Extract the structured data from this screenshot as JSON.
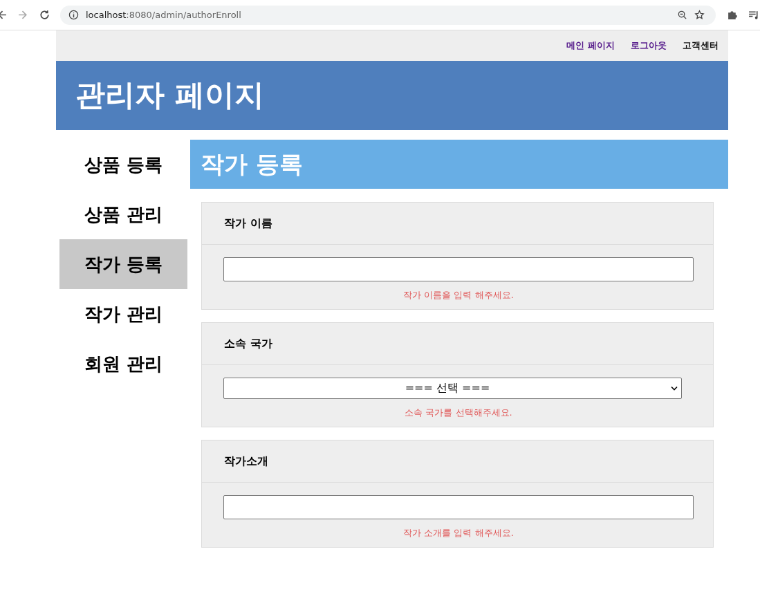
{
  "browser": {
    "url_host": "localhost",
    "url_rest": ":8080/admin/authorEnroll"
  },
  "top_links": [
    {
      "label": "메인 페이지",
      "visited": true
    },
    {
      "label": "로그아웃",
      "visited": true
    },
    {
      "label": "고객센터",
      "visited": false
    }
  ],
  "banner_title": "관리자 페이지",
  "sidebar": {
    "items": [
      {
        "label": "상품 등록",
        "selected": false
      },
      {
        "label": "상품 관리",
        "selected": false
      },
      {
        "label": "작가 등록",
        "selected": true
      },
      {
        "label": "작가 관리",
        "selected": false
      },
      {
        "label": "회원 관리",
        "selected": false
      }
    ]
  },
  "content_title": "작가 등록",
  "fields": [
    {
      "kind": "text",
      "label": "작가 이름",
      "warning": "작가 이름을 입력 해주세요."
    },
    {
      "kind": "select",
      "label": "소속 국가",
      "value": "=== 선택 ===",
      "warning": "소속 국가를 선택해주세요."
    },
    {
      "kind": "text",
      "label": "작가소개",
      "warning": "작가 소개를 입력 해주세요."
    }
  ]
}
